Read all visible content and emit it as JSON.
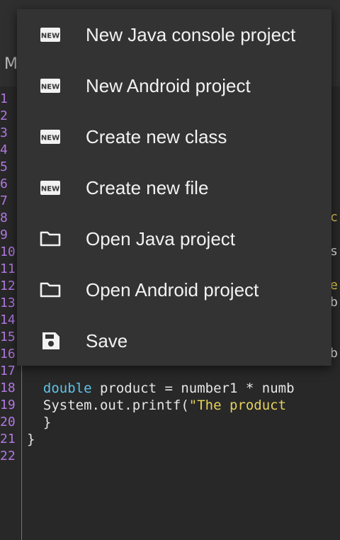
{
  "tab": {
    "label": "M"
  },
  "menu": {
    "items": [
      {
        "label": "New Java console project",
        "icon": "new-badge-icon"
      },
      {
        "label": "New Android project",
        "icon": "new-badge-icon"
      },
      {
        "label": "Create new class",
        "icon": "new-badge-icon"
      },
      {
        "label": "Create new file",
        "icon": "new-badge-icon"
      },
      {
        "label": "Open Java project",
        "icon": "folder-icon"
      },
      {
        "label": "Open Android project",
        "icon": "folder-icon"
      },
      {
        "label": "Save",
        "icon": "save-icon"
      }
    ]
  },
  "editor": {
    "line_numbers": [
      "1",
      "2",
      "3",
      "4",
      "5",
      "6",
      "7",
      "8",
      "9",
      "10",
      "11",
      "12",
      "13",
      "14",
      "15",
      "16",
      "17",
      "18",
      "19",
      "20",
      "21",
      "22"
    ],
    "fragments": [
      "c",
      "s",
      "e",
      "b",
      "b"
    ],
    "line18": {
      "kw": "double",
      "rest": " product = number1 * numb"
    },
    "line19": {
      "pre": "System.out.printf(",
      "str": "\"The product "
    },
    "line20": "  }",
    "line21": "}"
  },
  "colors": {
    "keyword": "#5fc3e8",
    "string": "#e6d15a",
    "line_number": "#b178e0",
    "menu_bg": "#333333"
  }
}
